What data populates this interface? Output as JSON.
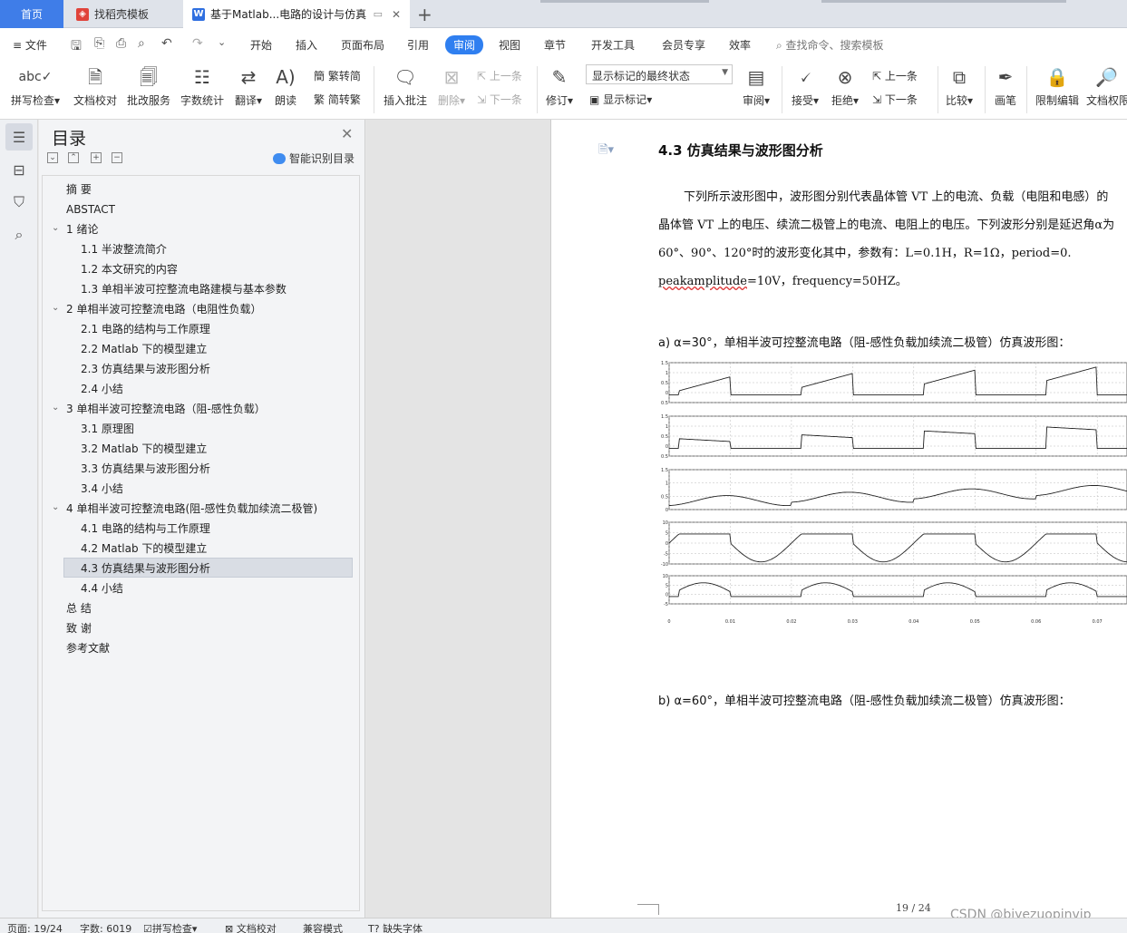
{
  "tabs": {
    "home": "首页",
    "template": "找稻壳模板",
    "document": "基于Matlab...电路的设计与仿真"
  },
  "menu": {
    "file": "文件",
    "items": [
      "开始",
      "插入",
      "页面布局",
      "引用",
      "审阅",
      "视图",
      "章节",
      "开发工具",
      "会员专享",
      "效率"
    ],
    "active": "审阅",
    "search": "查找命令、搜索模板"
  },
  "ribbon": {
    "spellcheck": "拼写检查",
    "doc_check": "文档校对",
    "batch_service": "批改服务",
    "word_count": "字数统计",
    "translate": "翻译",
    "read_aloud": "朗读",
    "to_traditional": "繁转简",
    "to_simplified": "简转繁",
    "insert_comment": "插入批注",
    "delete": "删除",
    "prev": "上一条",
    "next": "下一条",
    "revise": "修订",
    "markup_state": "显示标记的最终状态",
    "show_markup": "显示标记",
    "review": "审阅",
    "accept": "接受",
    "reject": "拒绝",
    "prev2": "上一条",
    "next2": "下一条",
    "compare": "比较",
    "pen": "画笔",
    "restrict_edit": "限制编辑",
    "doc_permission": "文档权限"
  },
  "toc": {
    "title": "目录",
    "smart": "智能识别目录",
    "items": [
      {
        "text": "摘  要",
        "level": 1,
        "arrow": false
      },
      {
        "text": "ABSTACT",
        "level": 1,
        "arrow": false
      },
      {
        "text": "1  绪论",
        "level": 1,
        "arrow": true
      },
      {
        "text": "1.1 半波整流简介",
        "level": 2,
        "arrow": false
      },
      {
        "text": "1.2  本文研究的内容",
        "level": 2,
        "arrow": false
      },
      {
        "text": "1.3  单相半波可控整流电路建模与基本参数",
        "level": 2,
        "arrow": false
      },
      {
        "text": "2  单相半波可控整流电路（电阻性负载）",
        "level": 1,
        "arrow": true
      },
      {
        "text": "2.1  电路的结构与工作原理",
        "level": 2,
        "arrow": false
      },
      {
        "text": "2.2 Matlab 下的模型建立",
        "level": 2,
        "arrow": false
      },
      {
        "text": "2.3  仿真结果与波形图分析",
        "level": 2,
        "arrow": false
      },
      {
        "text": "2.4  小结",
        "level": 2,
        "arrow": false
      },
      {
        "text": "3  单相半波可控整流电路（阻-感性负载）",
        "level": 1,
        "arrow": true
      },
      {
        "text": "3.1  原理图",
        "level": 2,
        "arrow": false
      },
      {
        "text": "3.2 Matlab 下的模型建立",
        "level": 2,
        "arrow": false
      },
      {
        "text": "3.3  仿真结果与波形图分析",
        "level": 2,
        "arrow": false
      },
      {
        "text": "3.4  小结",
        "level": 2,
        "arrow": false
      },
      {
        "text": "4  单相半波可控整流电路(阻-感性负载加续流二极管)",
        "level": 1,
        "arrow": true
      },
      {
        "text": "4.1  电路的结构与工作原理",
        "level": 2,
        "arrow": false
      },
      {
        "text": "4.2 Matlab 下的模型建立",
        "level": 2,
        "arrow": false
      },
      {
        "text": "4.3  仿真结果与波形图分析",
        "level": 2,
        "arrow": false,
        "selected": true
      },
      {
        "text": "4.4  小结",
        "level": 2,
        "arrow": false
      },
      {
        "text": "总  结",
        "level": 1,
        "arrow": false
      },
      {
        "text": "致  谢",
        "level": 1,
        "arrow": false
      },
      {
        "text": "参考文献",
        "level": 1,
        "arrow": false
      }
    ]
  },
  "document": {
    "heading": "4.3  仿真结果与波形图分析",
    "para1_line1": "下列所示波形图中，波形图分别代表晶体管 VT 上的电流、负载（电阻和电感）的",
    "para1_line2": "晶体管 VT 上的电压、续流二极管上的电流、电阻上的电压。下列波形分别是延迟角α为",
    "para1_line3": "60°、90°、120°时的波形变化其中，参数有：L=0.1H，R=1Ω，period=0.",
    "para1_line4_a": "peakamplitude",
    "para1_line4_b": "=10V，frequency=50HZ。",
    "caption_a": "a)   α=30°，单相半波可控整流电路（阻-感性负载加续流二极管）仿真波形图：",
    "caption_b": "b)   α=60°，单相半波可控整流电路（阻-感性负载加续流二极管）仿真波形图：",
    "page_number": "19 / 24"
  },
  "chart_data": {
    "type": "line",
    "x_ticks": [
      "0",
      "0.01",
      "0.02",
      "0.03",
      "0.04",
      "0.05",
      "0.06",
      "0.07"
    ],
    "panels": [
      {
        "y_ticks": [
          "1.5",
          "1",
          "0.5",
          "0",
          "-0.5"
        ]
      },
      {
        "y_ticks": [
          "1.5",
          "1",
          "0.5",
          "0",
          "-0.5"
        ]
      },
      {
        "y_ticks": [
          "1.5",
          "1",
          "0.5",
          "0"
        ]
      },
      {
        "y_ticks": [
          "10",
          "5",
          "0",
          "-5",
          "-10"
        ]
      },
      {
        "y_ticks": [
          "10",
          "5",
          "0",
          "-5"
        ]
      }
    ]
  },
  "status": {
    "page": "页面: 19/24",
    "words": "字数: 6019",
    "spellcheck": "拼写检查",
    "doccheck": "文档校对",
    "compat": "兼容模式",
    "missing_font": "缺失字体"
  },
  "watermark": "CSDN @biyezuopinvip"
}
